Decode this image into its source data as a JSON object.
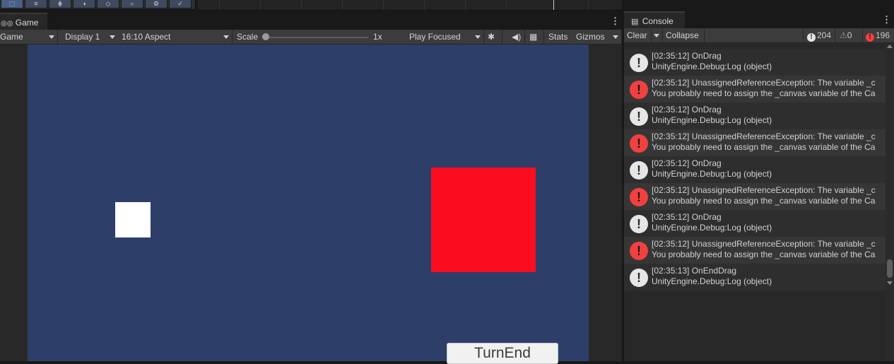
{
  "game_panel": {
    "tab_label": "Game",
    "tab_icon": "gamepad-icon",
    "toolbar": {
      "mode_label": "Game",
      "display_label": "Display 1",
      "aspect_label": "16:10 Aspect",
      "scale_label": "Scale",
      "scale_value": "1x",
      "play_mode_label": "Play Focused",
      "stats_label": "Stats",
      "gizmos_label": "Gizmos"
    },
    "viewport": {
      "background": "#2d3f69",
      "white_square_color": "#ffffff",
      "red_square_color": "#fb0d20",
      "turn_end_label": "TurnEnd"
    }
  },
  "console_panel": {
    "tab_label": "Console",
    "tab_icon": "console-icon",
    "toolbar": {
      "clear_label": "Clear",
      "collapse_label": "Collapse",
      "log_count": "204",
      "warning_count": "0",
      "error_count": "196"
    },
    "entries": [
      {
        "type": "log",
        "line1": "[02:35:12] OnDrag",
        "line2": "UnityEngine.Debug:Log (object)"
      },
      {
        "type": "error",
        "line1": "[02:35:12] UnassignedReferenceException: The variable _c",
        "line2": "You probably need to assign the _canvas variable of the Ca"
      },
      {
        "type": "log",
        "line1": "[02:35:12] OnDrag",
        "line2": "UnityEngine.Debug:Log (object)"
      },
      {
        "type": "error",
        "line1": "[02:35:12] UnassignedReferenceException: The variable _c",
        "line2": "You probably need to assign the _canvas variable of the Ca"
      },
      {
        "type": "log",
        "line1": "[02:35:12] OnDrag",
        "line2": "UnityEngine.Debug:Log (object)"
      },
      {
        "type": "error",
        "line1": "[02:35:12] UnassignedReferenceException: The variable _c",
        "line2": "You probably need to assign the _canvas variable of the Ca"
      },
      {
        "type": "log",
        "line1": "[02:35:12] OnDrag",
        "line2": "UnityEngine.Debug:Log (object)"
      },
      {
        "type": "error",
        "line1": "[02:35:12] UnassignedReferenceException: The variable _c",
        "line2": "You probably need to assign the _canvas variable of the Ca"
      },
      {
        "type": "log",
        "line1": "[02:35:13] OnEndDrag",
        "line2": "UnityEngine.Debug:Log (object)"
      }
    ]
  }
}
